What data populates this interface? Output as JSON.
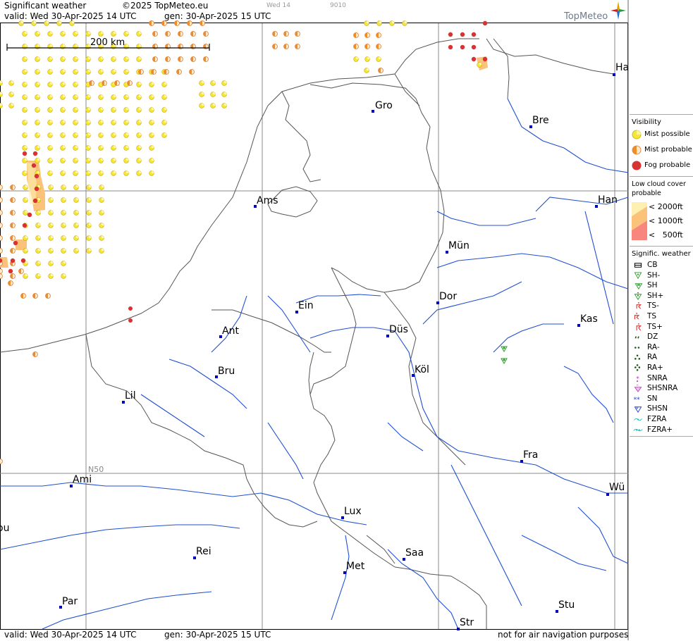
{
  "header": {
    "title": "Significant weather",
    "copyright": "©2025 TopMeteo.eu",
    "valid": "valid:  Wed  30-Apr-2025  14 UTC",
    "generated": "gen:  30-Apr-2025  15 UTC",
    "small_day": "Wed 14",
    "small_code": "9010",
    "brand": "TopMeteo"
  },
  "scale_label": "200 km",
  "lat_label": "N50",
  "cities": [
    {
      "name": "Ha"
    },
    {
      "name": "Gro"
    },
    {
      "name": "Bre"
    },
    {
      "name": "Ams"
    },
    {
      "name": "Han"
    },
    {
      "name": "Mün"
    },
    {
      "name": "Ein"
    },
    {
      "name": "Dor"
    },
    {
      "name": "Kas"
    },
    {
      "name": "Ant"
    },
    {
      "name": "Düs"
    },
    {
      "name": "Bru"
    },
    {
      "name": "Köl"
    },
    {
      "name": "Lil"
    },
    {
      "name": "Fra"
    },
    {
      "name": "Ami"
    },
    {
      "name": "Wü"
    },
    {
      "name": "Lux"
    },
    {
      "name": "ou"
    },
    {
      "name": "Rei"
    },
    {
      "name": "Saa"
    },
    {
      "name": "Met"
    },
    {
      "name": "Par"
    },
    {
      "name": "Stu"
    },
    {
      "name": "Str"
    }
  ],
  "legend": {
    "visibility_title": "Visibility",
    "visibility": [
      {
        "label": "Mist possible",
        "icon": "mist-possible-icon",
        "color": "#f5e63c"
      },
      {
        "label": "Mist probable",
        "icon": "mist-probable-icon",
        "color": "#f08c28"
      },
      {
        "label": "Fog probable",
        "icon": "fog-probable-icon",
        "color": "#d83232"
      }
    ],
    "cloud_title": "Low cloud cover probable",
    "cloud": [
      {
        "label": "< 2000ft",
        "color": "#fdf0b0"
      },
      {
        "label": "< 1000ft",
        "color": "#fbc27a"
      },
      {
        "label": "<   500ft",
        "color": "#f8867c"
      }
    ],
    "weather_title": "Signific. weather",
    "weather": [
      {
        "label": "CB",
        "icon": "cb-icon",
        "color": "#000000"
      },
      {
        "label": "SH-",
        "icon": "shower-light-icon",
        "color": "#2a9a2a"
      },
      {
        "label": "SH",
        "icon": "shower-icon",
        "color": "#2a9a2a"
      },
      {
        "label": "SH+",
        "icon": "shower-heavy-icon",
        "color": "#2a9a2a"
      },
      {
        "label": "TS-",
        "icon": "thunderstorm-light-icon",
        "color": "#d83232"
      },
      {
        "label": "TS",
        "icon": "thunderstorm-icon",
        "color": "#d83232"
      },
      {
        "label": "TS+",
        "icon": "thunderstorm-heavy-icon",
        "color": "#d83232"
      },
      {
        "label": "DZ",
        "icon": "drizzle-icon",
        "color": "#1a5a1a"
      },
      {
        "label": "RA-",
        "icon": "rain-light-icon",
        "color": "#1a5a1a"
      },
      {
        "label": "RA",
        "icon": "rain-icon",
        "color": "#1a5a1a"
      },
      {
        "label": "RA+",
        "icon": "rain-heavy-icon",
        "color": "#1a5a1a"
      },
      {
        "label": "SNRA",
        "icon": "snow-rain-icon",
        "color": "#c040c0"
      },
      {
        "label": "SHSNRA",
        "icon": "snow-rain-shower-icon",
        "color": "#c040c0"
      },
      {
        "label": "SN",
        "icon": "snow-icon",
        "color": "#2040d0"
      },
      {
        "label": "SHSN",
        "icon": "snow-shower-icon",
        "color": "#2040d0"
      },
      {
        "label": "FZRA",
        "icon": "freezing-rain-icon",
        "color": "#20c0c0"
      },
      {
        "label": "FZRA+",
        "icon": "freezing-rain-heavy-icon",
        "color": "#20c0c0"
      }
    ]
  },
  "footer": {
    "valid": "valid:  Wed  30-Apr-2025  14 UTC",
    "generated": "gen:  30-Apr-2025  15 UTC",
    "disclaimer": "not for air navigation purposes"
  },
  "colors": {
    "river": "#2050d0",
    "border": "#555555",
    "grid": "#888888",
    "city": "#0000c0"
  }
}
